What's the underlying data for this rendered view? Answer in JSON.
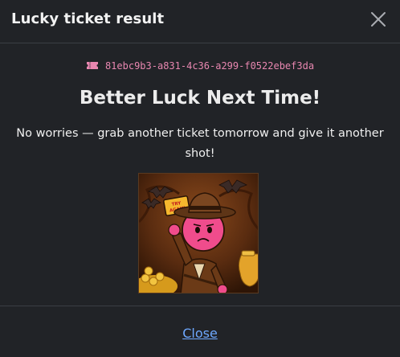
{
  "modal": {
    "title": "Lucky ticket result",
    "ticket_id": "81ebc9b3-a831-4c36-a299-f0522ebef3da",
    "headline": "Better Luck Next Time!",
    "message": "No worries — grab another ticket tomorrow and give it another shot!",
    "image_sign_text": "TRY AGAIN",
    "close_label": "Close"
  },
  "colors": {
    "background": "#212327",
    "accent_pink": "#e887b0",
    "link_blue": "#6ea8fe"
  },
  "icons": {
    "close": "close-icon",
    "ticket": "ticket-icon"
  }
}
